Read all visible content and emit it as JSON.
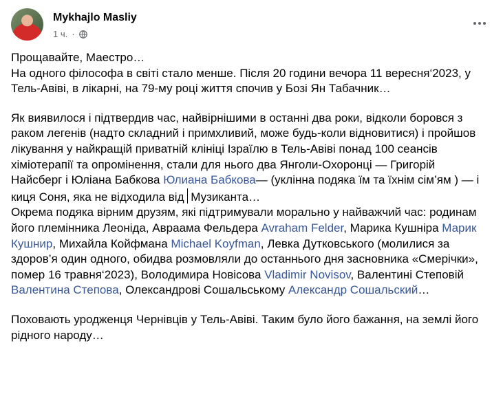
{
  "author": {
    "name": "Mykhajlo Masliy",
    "time": "1 ч.",
    "dot": "·"
  },
  "paragraphs": {
    "p1": [
      "Прощавайте, Маестро…",
      "На одного філософа в світі стало менше. Після 20 години вечора 11 вересня‘2023, у Тель-Авіві, в лікарні, на 79-му році життя спочив у Бозі Ян Табачник…"
    ],
    "p2": {
      "t1": "Як виявилося і підтвердив час, найвірнішими в останні два роки, відколи боровся з раком легенів (надто складний і примхливий, може будь-коли відновитися) і пройшов лікування у найкращій приватній клініці Ізраїлю в Тель-Авіві понад 100 сеансів хіміотерапії та опромінення, стали для нього два Янголи-Охоронці — Григорій Найсберг і Юліана Бабкова ",
      "m1": "Юлиана Бабкова",
      "t2": "— (уклінна подяка їм та їхнім сім’ям ) — і киця Соня, яка не відходила від",
      "t3": " Музиканта…",
      "t4": "Окрема подяка вірним друзям, які підтримували морально у найважчий час: родинам його племінника Леоніда, Авраама Фельдера ",
      "m2": "Avraham Felder",
      "t5": ", Марика Кушніра ",
      "m3": "Марик Кушнир",
      "t6": ", Михайла Койфмана ",
      "m4": "Michael Koyfman",
      "t7": ", Левка Дутковського (молилися за здоров’я один одного, обидва розмовляли до останнього дня засновника «Смерічки», помер 16 травня‘2023), Володимира Новісова ",
      "m5": "Vladimir Novisov",
      "t8": ", Валентині Степовій ",
      "m6": "Валентина Степова",
      "t9": ", Олександрові Сошальському ",
      "m7": "Александр Сошальский",
      "t10": "…"
    },
    "p3": "Поховають уродженця Чернівців у  Тель-Авіві. Таким було його бажання, на землі його рідного народу…"
  }
}
